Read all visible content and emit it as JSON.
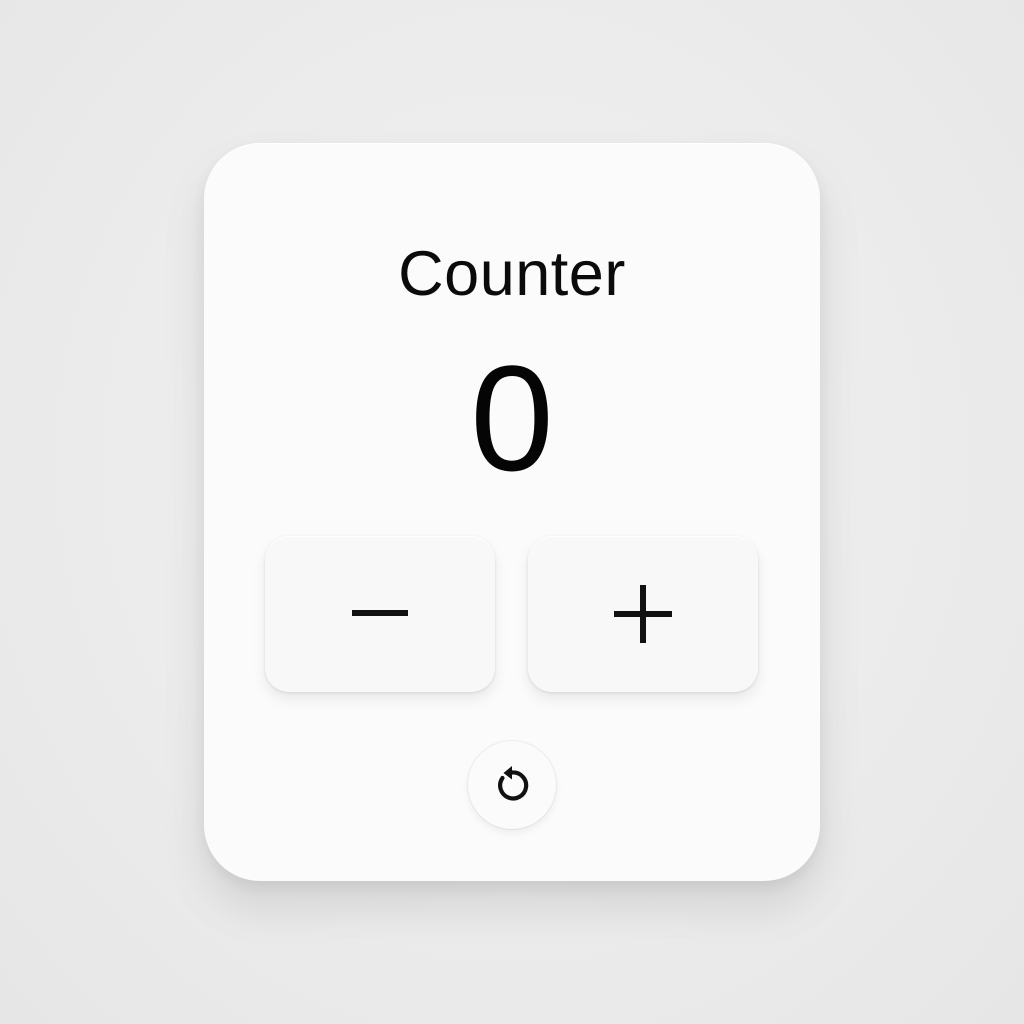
{
  "counter": {
    "title": "Counter",
    "value": "0"
  },
  "buttons": {
    "decrement_icon": "minus-icon",
    "increment_icon": "plus-icon",
    "reset_icon": "reset-arrow-icon"
  },
  "colors": {
    "background": "#ececec",
    "card": "#fbfbfb",
    "text": "#0b0b0b"
  }
}
